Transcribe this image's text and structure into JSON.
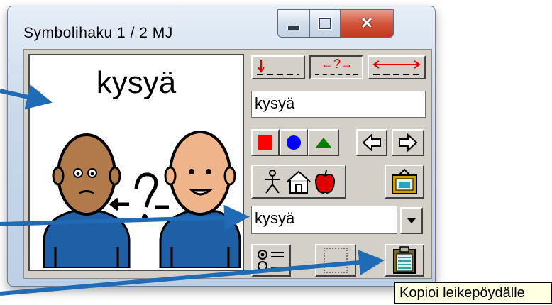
{
  "window": {
    "title": "Symbolihaku  1 / 2   MJ",
    "minimize_icon": "minimize-icon",
    "maximize_icon": "maximize-icon",
    "close_icon": "close-icon"
  },
  "preview": {
    "word": "kysyä",
    "symbol_icon": "two-persons-asking-icon"
  },
  "toolbar": {
    "direction_buttons": [
      {
        "icon": "arrow-down-underscore-icon"
      },
      {
        "icon": "question-arrows-icon",
        "label": "←?→"
      },
      {
        "icon": "double-arrow-icon"
      }
    ],
    "color_buttons": [
      {
        "icon": "red-square-icon",
        "color": "#ff0000"
      },
      {
        "icon": "blue-circle-icon",
        "color": "#0000ff"
      },
      {
        "icon": "green-triangle-icon",
        "color": "#008000"
      }
    ],
    "nav_left_icon": "arrow-left-outline-icon",
    "nav_right_icon": "arrow-right-outline-icon",
    "category_icons": [
      "person-icon",
      "house-icon",
      "apple-icon"
    ],
    "picture_frame_icon": "framed-picture-icon",
    "list_icon": "radio-list-icon",
    "blank_icon": "blank-frame-icon",
    "clipboard_icon": "clipboard-icon"
  },
  "search_field": {
    "value": "kysyä"
  },
  "combo": {
    "value": "kysyä",
    "dropdown_icon": "chevron-down-icon"
  },
  "tooltip": {
    "text": "Kopioi leikepöydälle"
  },
  "accent_color": "#1f6bb5"
}
